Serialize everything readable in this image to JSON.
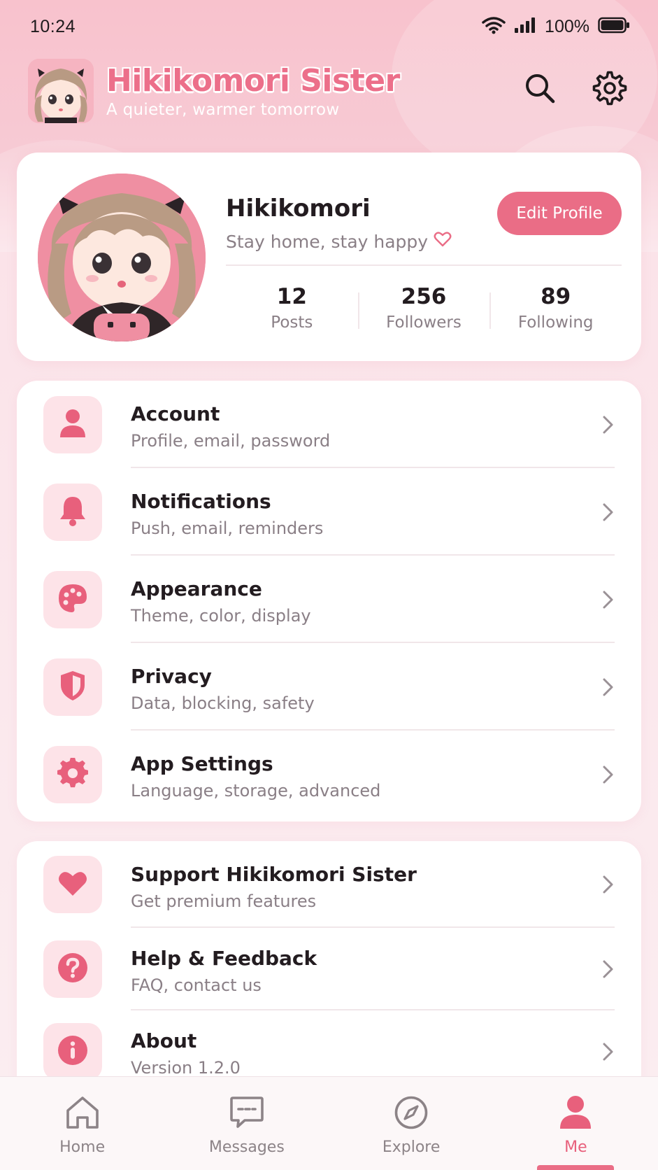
{
  "status_bar": {
    "time": "10:24",
    "battery": "100%"
  },
  "header": {
    "app_title": "Hikikomori Sister",
    "tagline": "A quieter, warmer tomorrow",
    "icons": [
      "search-icon",
      "gear-icon"
    ]
  },
  "profile": {
    "name": "Hikikomori",
    "status": "Stay home, stay happy",
    "edit_label": "Edit Profile",
    "stats": [
      {
        "value": "12",
        "label": "Posts"
      },
      {
        "value": "256",
        "label": "Followers"
      },
      {
        "value": "89",
        "label": "Following"
      }
    ]
  },
  "settings_group": [
    {
      "title": "Account",
      "subtitle": "Profile, email, password",
      "icon": "user-icon"
    },
    {
      "title": "Notifications",
      "subtitle": "Push, email, reminders",
      "icon": "bell-icon"
    },
    {
      "title": "Appearance",
      "subtitle": "Theme, color, display",
      "icon": "palette-icon"
    },
    {
      "title": "Privacy",
      "subtitle": "Data, blocking, safety",
      "icon": "shield-icon"
    },
    {
      "title": "App Settings",
      "subtitle": "Language, storage, advanced",
      "icon": "gear-icon"
    }
  ],
  "support_group": [
    {
      "title": "Support Hikikomori Sister",
      "subtitle": "Get premium features",
      "icon": "heart-icon"
    },
    {
      "title": "Help & Feedback",
      "subtitle": "FAQ, contact us",
      "icon": "question-icon"
    },
    {
      "title": "About",
      "subtitle": "Version 1.2.0",
      "icon": "info-icon"
    }
  ],
  "bottom_nav": {
    "items": [
      {
        "label": "Home",
        "icon": "home-icon"
      },
      {
        "label": "Messages",
        "icon": "message-icon"
      },
      {
        "label": "Explore",
        "icon": "compass-icon"
      },
      {
        "label": "Me",
        "icon": "user-icon"
      }
    ],
    "active": "Me"
  },
  "colors": {
    "accent": "#ea6d86",
    "icon_bg": "#fde3e8",
    "header_bg": "#f8c2cd"
  }
}
